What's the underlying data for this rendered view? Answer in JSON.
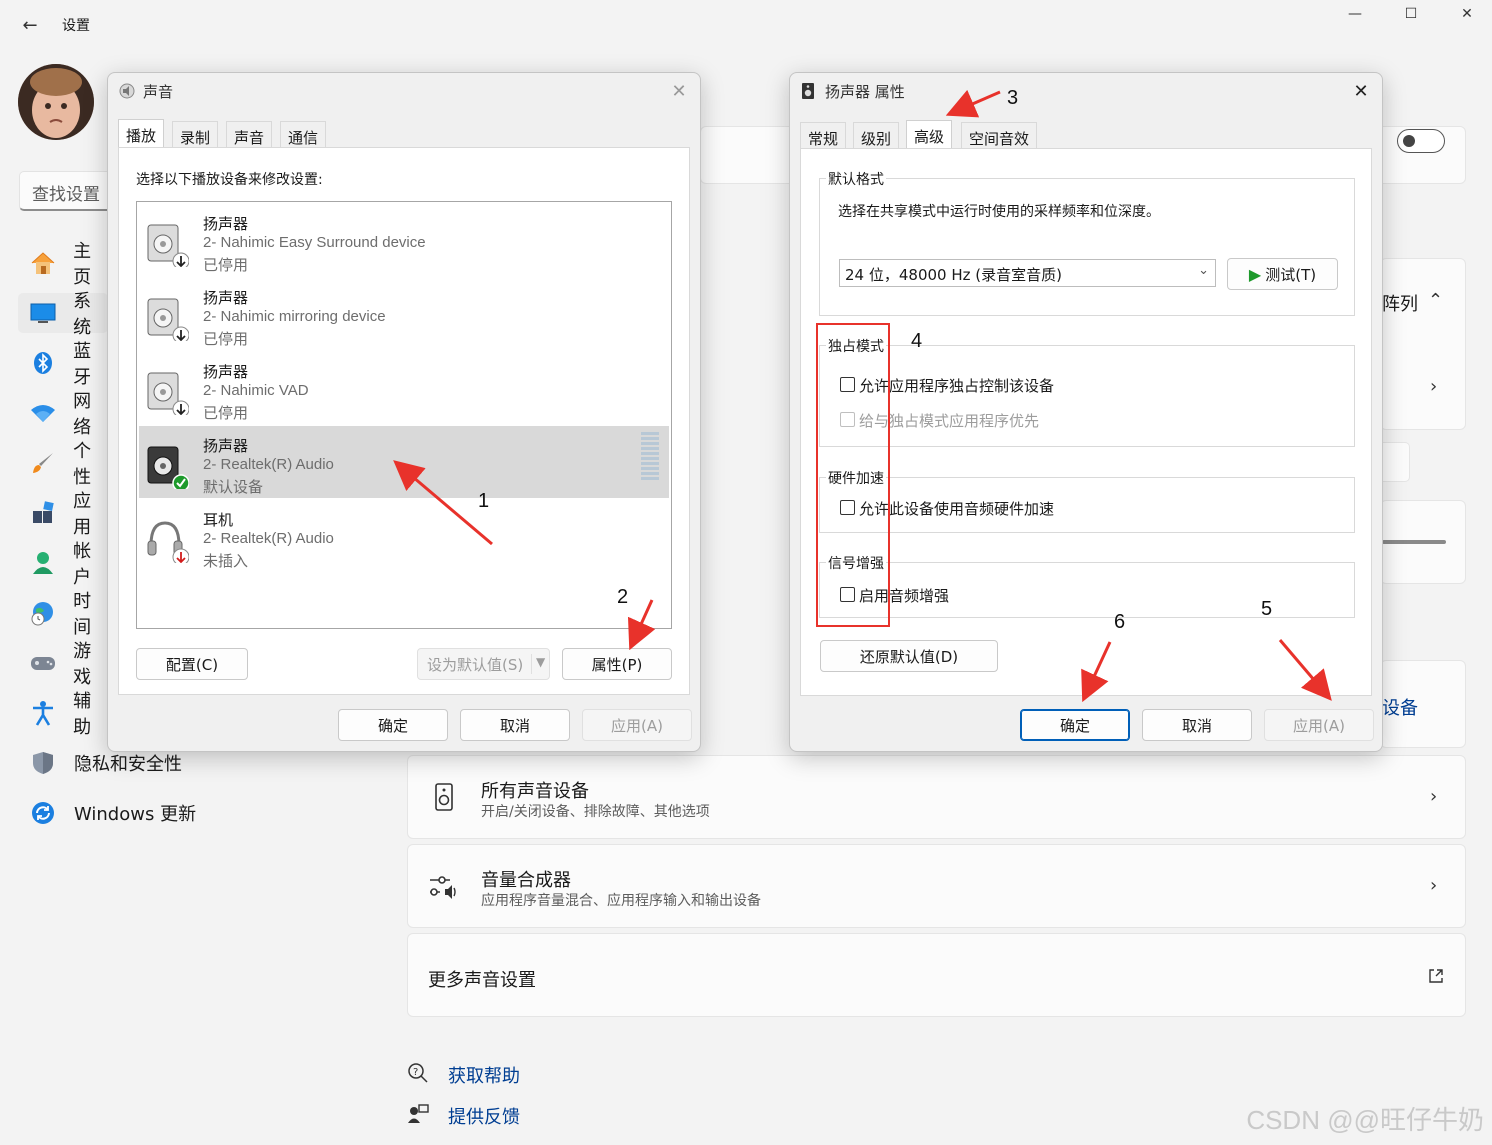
{
  "settings": {
    "title": "设置",
    "search_placeholder": "查找设置",
    "nav": [
      {
        "label": "主页",
        "icon": "home-icon"
      },
      {
        "label": "系统",
        "icon": "monitor-icon"
      },
      {
        "label": "蓝牙",
        "icon": "bluetooth-icon"
      },
      {
        "label": "网络",
        "icon": "wifi-icon"
      },
      {
        "label": "个性",
        "icon": "brush-icon"
      },
      {
        "label": "应用",
        "icon": "apps-icon"
      },
      {
        "label": "帐户",
        "icon": "user-icon"
      },
      {
        "label": "时间",
        "icon": "clock-globe-icon"
      },
      {
        "label": "游戏",
        "icon": "gamepad-icon"
      },
      {
        "label": "辅助",
        "icon": "accessibility-icon"
      },
      {
        "label": "隐私和安全性",
        "icon": "shield-icon"
      },
      {
        "label": "Windows 更新",
        "icon": "update-icon"
      }
    ],
    "partial_right_text_1": "阵列",
    "partial_right_text_2": "设备",
    "cards": {
      "all_devices": {
        "title": "所有声音设备",
        "subtitle": "开启/关闭设备、排除故障、其他选项"
      },
      "mixer": {
        "title": "音量合成器",
        "subtitle": "应用程序音量混合、应用程序输入和输出设备"
      },
      "more": {
        "title": "更多声音设置"
      }
    },
    "help_link": "获取帮助",
    "feedback_link": "提供反馈",
    "watermark": "CSDN @@旺仔牛奶"
  },
  "sound_dialog": {
    "title": "声音",
    "tabs": [
      "播放",
      "录制",
      "声音",
      "通信"
    ],
    "instruction": "选择以下播放设备来修改设置:",
    "devices": [
      {
        "name": "扬声器",
        "line2": "2- Nahimic Easy Surround device",
        "status": "已停用",
        "badge": "disabled-down-arrow"
      },
      {
        "name": "扬声器",
        "line2": "2- Nahimic mirroring device",
        "status": "已停用",
        "badge": "disabled-down-arrow"
      },
      {
        "name": "扬声器",
        "line2": "2- Nahimic VAD",
        "status": "已停用",
        "badge": "disabled-down-arrow"
      },
      {
        "name": "扬声器",
        "line2": "2- Realtek(R) Audio",
        "status": "默认设备",
        "badge": "default-check"
      },
      {
        "name": "耳机",
        "line2": "2- Realtek(R) Audio",
        "status": "未插入",
        "badge": "unplugged-arrow"
      }
    ],
    "configure_btn": "配置(C)",
    "set_default_btn": "设为默认值(S)",
    "properties_btn": "属性(P)",
    "ok_btn": "确定",
    "cancel_btn": "取消",
    "apply_btn": "应用(A)"
  },
  "props_dialog": {
    "title": "扬声器 属性",
    "tabs": [
      "常规",
      "级别",
      "高级",
      "空间音效"
    ],
    "default_format_label": "默认格式",
    "default_format_desc": "选择在共享模式中运行时使用的采样频率和位深度。",
    "format_value": "24 位，48000 Hz (录音室音质)",
    "test_btn": "测试(T)",
    "exclusive_label": "独占模式",
    "exclusive_opt1": "允许应用程序独占控制该设备",
    "exclusive_opt2": "给与独占模式应用程序优先",
    "hw_label": "硬件加速",
    "hw_opt": "允许此设备使用音频硬件加速",
    "signal_label": "信号增强",
    "signal_opt": "启用音频增强",
    "restore_btn": "还原默认值(D)",
    "ok_btn": "确定",
    "cancel_btn": "取消",
    "apply_btn": "应用(A)"
  },
  "annotations": [
    "1",
    "2",
    "3",
    "4",
    "5",
    "6"
  ],
  "colors": {
    "accent": "#005fb8",
    "annotation_red": "#e8322b",
    "link": "#003e92"
  }
}
